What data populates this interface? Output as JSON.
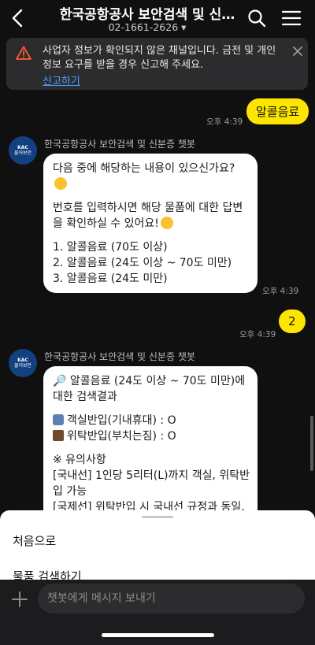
{
  "header": {
    "title": "한국공항공사 보안검색 및 신…",
    "phone": "02-1661-2626 ▾"
  },
  "warning": {
    "text": "사업자 정보가 확인되지 않은 채널입니다. 금전 및 개인정보 요구를 받을 경우 신고해 주세요.",
    "link": "신고하기"
  },
  "messages": {
    "m1": {
      "text": "알콜음료",
      "time": "오후 4:39"
    },
    "b1": {
      "sender": "한국공항공사 보안검색 및 신분증 챗봇",
      "avatar_line1": "KAC",
      "avatar_line2": "물어보안",
      "line1": "다음 중에 해당하는 내용이 있으신가요?",
      "line2": "번호를 입력하시면 해당 물품에 대한 답변",
      "line3": "을 확인하실 수 있어요!",
      "opt1": "1. 알콜음료 (70도 이상)",
      "opt2": "2. 알콜음료 (24도 이상 ~ 70도 미만)",
      "opt3": "3. 알콜음료 (24도 미만)",
      "time": "오후 4:39"
    },
    "m2": {
      "text": "2",
      "time": "오후 4:39"
    },
    "b2": {
      "sender": "한국공항공사 보안검색 및 신분증 챗봇",
      "avatar_line1": "KAC",
      "avatar_line2": "물어보안",
      "line1": "🔎 알콜음료 (24도 이상 ~ 70도 미만)에",
      "line2": "대한 검색결과",
      "cabin": "객실반입(기내휴대) : O",
      "checked": "위탁반입(부치는짐) : O",
      "note_title": "※ 유의사항",
      "note1": "[국내선] 1인당 5리터(L)까지 객실, 위탁반",
      "note2": "입 가능",
      "note3": "[국제선] 위탁반입 시 국내선 규정과 동일,"
    }
  },
  "sheet": {
    "item1": "처음으로",
    "item2": "물품 검색하기"
  },
  "input": {
    "placeholder": "챗봇에게 메시지 보내기"
  }
}
